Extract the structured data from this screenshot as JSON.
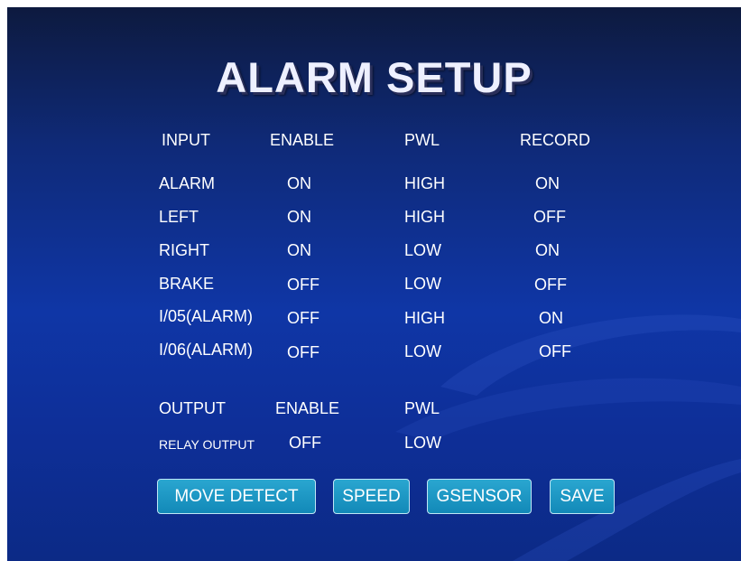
{
  "title": "ALARM SETUP",
  "input_section": {
    "headers": [
      "INPUT",
      "ENABLE",
      "PWL",
      "RECORD"
    ],
    "rows": [
      {
        "input": "ALARM",
        "enable": "ON",
        "pwl": "HIGH",
        "record": "ON"
      },
      {
        "input": "LEFT",
        "enable": "ON",
        "pwl": "HIGH",
        "record": "OFF"
      },
      {
        "input": "RIGHT",
        "enable": "ON",
        "pwl": "LOW",
        "record": "ON"
      },
      {
        "input": "BRAKE",
        "enable": "OFF",
        "pwl": "LOW",
        "record": "OFF"
      },
      {
        "input": "I/05(ALARM)",
        "enable": "OFF",
        "pwl": "HIGH",
        "record": "ON"
      },
      {
        "input": "I/06(ALARM)",
        "enable": "OFF",
        "pwl": "LOW",
        "record": "OFF"
      }
    ]
  },
  "output_section": {
    "headers": [
      "OUTPUT",
      "ENABLE",
      "PWL"
    ],
    "rows": [
      {
        "output": "RELAY OUTPUT",
        "enable": "OFF",
        "pwl": "LOW"
      }
    ]
  },
  "buttons": {
    "move_detect": "MOVE  DETECT",
    "speed": "SPEED",
    "gsensor": "GSENSOR",
    "save": "SAVE"
  },
  "colors": {
    "background": "#0f36a6",
    "text": "#ffffff",
    "button": "#1a96c4",
    "button_border": "#bfe6f5"
  }
}
